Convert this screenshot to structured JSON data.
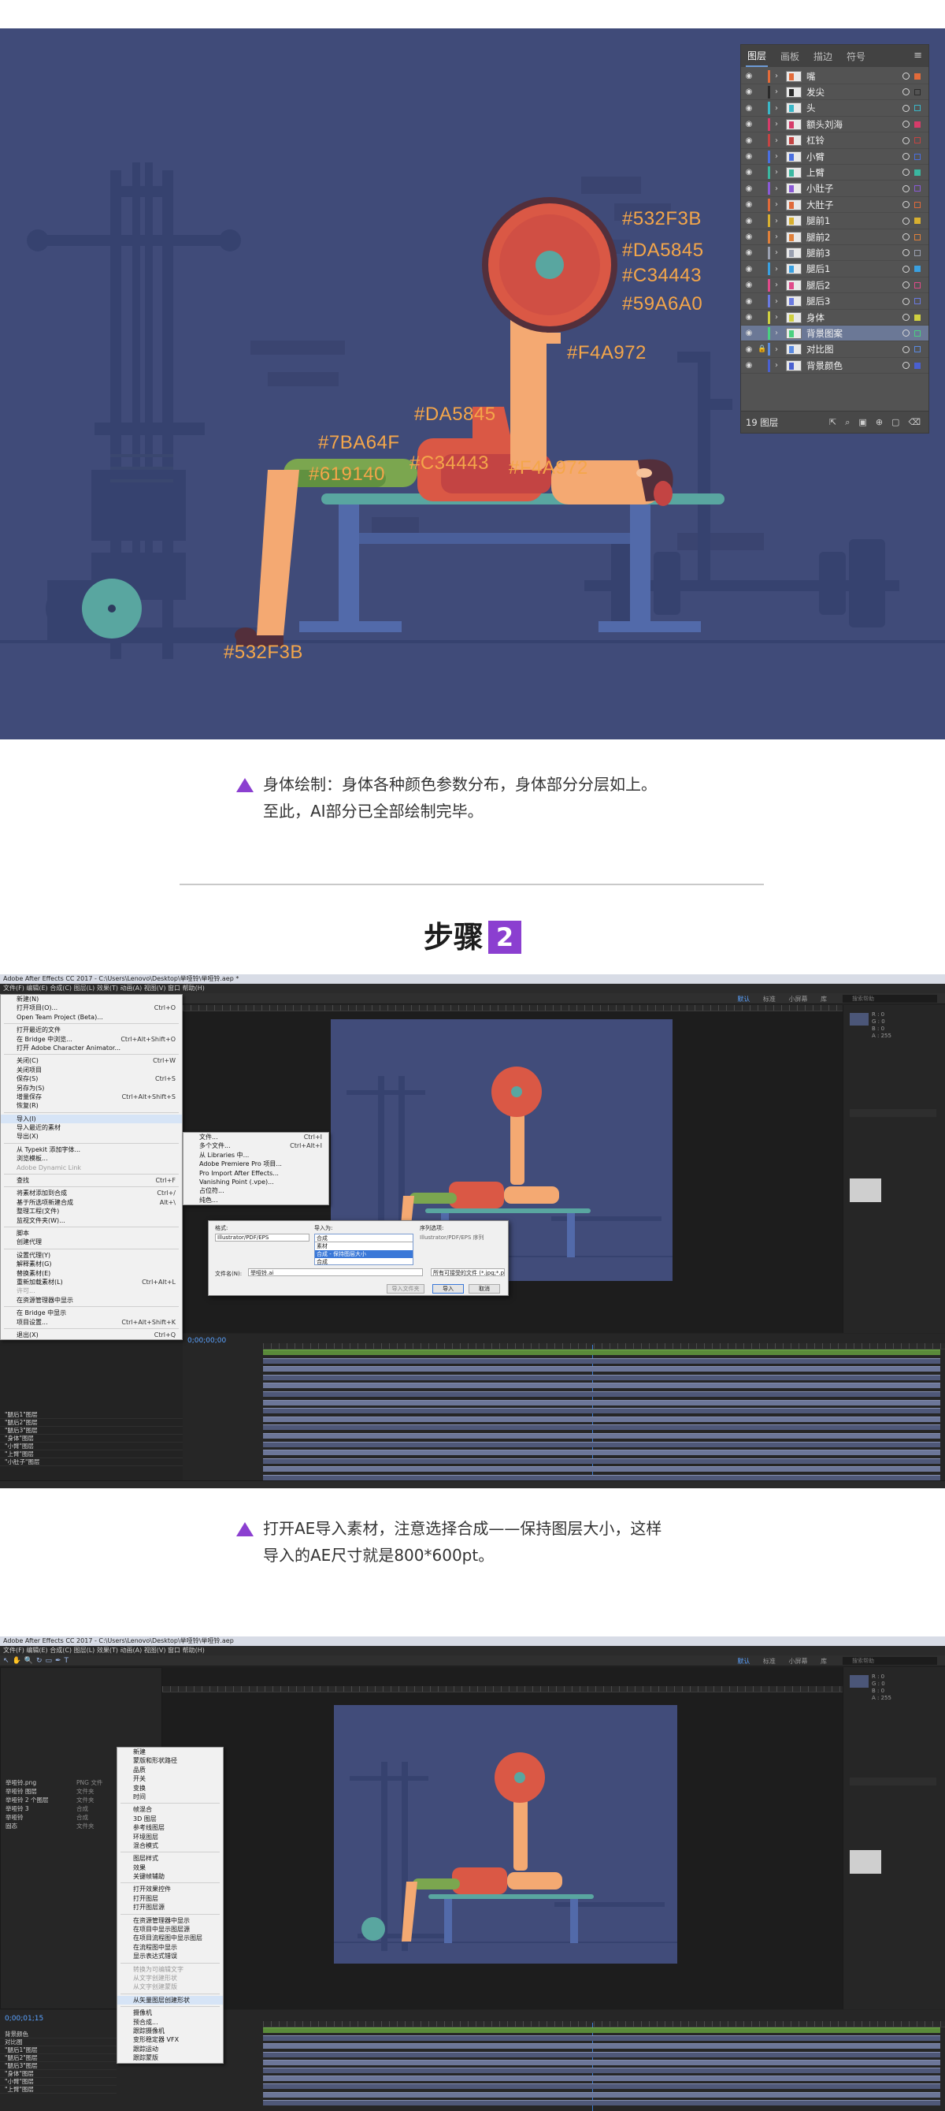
{
  "hero": {
    "background": "#404b79",
    "color_labels": [
      "#532F3B",
      "#DA5845",
      "#C34443",
      "#59A6A0",
      "#F4A972",
      "#DA5845",
      "#7BA64F",
      "#619140",
      "#C34443",
      "#F4A972",
      "#532F3B"
    ],
    "layers_panel": {
      "tabs": [
        "图层",
        "画板",
        "描边",
        "符号"
      ],
      "menu_icon": "hamburger-icon",
      "layers": [
        {
          "name": "嘴",
          "color": "#e36b3a"
        },
        {
          "name": "发尖",
          "color": "#2b2b2b"
        },
        {
          "name": "头",
          "color": "#3ab7c8"
        },
        {
          "name": "额头刘海",
          "color": "#d63c6a"
        },
        {
          "name": "杠铃",
          "color": "#c34443"
        },
        {
          "name": "小臂",
          "color": "#4a6fe0"
        },
        {
          "name": "上臂",
          "color": "#3ab7a0"
        },
        {
          "name": "小肚子",
          "color": "#8a5ad6"
        },
        {
          "name": "大肚子",
          "color": "#e06a3a"
        },
        {
          "name": "腿前1",
          "color": "#d8b030"
        },
        {
          "name": "腿前2",
          "color": "#e0803a"
        },
        {
          "name": "腿前3",
          "color": "#9aa0b0"
        },
        {
          "name": "腿后1",
          "color": "#3aa0e0"
        },
        {
          "name": "腿后2",
          "color": "#e04a8a"
        },
        {
          "name": "腿后3",
          "color": "#6a7ae0"
        },
        {
          "name": "身体",
          "color": "#d0d040"
        },
        {
          "name": "背景图案",
          "color": "#4ad080"
        },
        {
          "name": "对比图",
          "color": "#5a8ae0"
        },
        {
          "name": "背景颜色",
          "color": "#4a60d0"
        }
      ],
      "footer_count": "19 图层"
    }
  },
  "caption1": "身体绘制：身体各种颜色参数分布，身体部分分层如上。\n至此，AI部分已全部绘制完毕。",
  "step": {
    "label": "步骤",
    "number": "2"
  },
  "caption2": "打开AE导入素材，注意选择合成——保持图层大小，这样\n导入的AE尺寸就是800*600pt。",
  "ae1": {
    "title": "Adobe After Effects CC 2017 - C:\\Users\\Lenovo\\Desktop\\举哑铃\\举哑铃.aep *",
    "menu": "文件(F)   编辑(E)   合成(C)   图层(L)   效果(T)   动画(A)   视图(V)   窗口   帮助(H)",
    "workspace": [
      "默认",
      "标准",
      "小屏幕",
      "库"
    ],
    "search_placeholder": "搜索帮助",
    "file_menu": [
      {
        "label": "新建(N)",
        "shortcut": ""
      },
      {
        "label": "打开项目(O)...",
        "shortcut": "Ctrl+O"
      },
      {
        "label": "Open Team Project (Beta)...",
        "shortcut": ""
      },
      {
        "label": "打开最近的文件",
        "shortcut": ""
      },
      {
        "label": "在 Bridge 中浏览...",
        "shortcut": "Ctrl+Alt+Shift+O"
      },
      {
        "label": "打开 Adobe Character Animator...",
        "shortcut": ""
      },
      {
        "label": "关闭(C)",
        "shortcut": "Ctrl+W"
      },
      {
        "label": "关闭项目",
        "shortcut": ""
      },
      {
        "label": "保存(S)",
        "shortcut": "Ctrl+S"
      },
      {
        "label": "另存为(S)",
        "shortcut": ""
      },
      {
        "label": "增量保存",
        "shortcut": "Ctrl+Alt+Shift+S"
      },
      {
        "label": "恢复(R)",
        "shortcut": ""
      },
      {
        "label": "导入(I)",
        "shortcut": ""
      },
      {
        "label": "导入最近的素材",
        "shortcut": ""
      },
      {
        "label": "导出(X)",
        "shortcut": ""
      },
      {
        "label": "从 Typekit 添加字体...",
        "shortcut": ""
      },
      {
        "label": "浏览模板...",
        "shortcut": ""
      },
      {
        "label": "Adobe Dynamic Link",
        "shortcut": ""
      },
      {
        "label": "查找",
        "shortcut": "Ctrl+F"
      },
      {
        "label": "将素材添加到合成",
        "shortcut": "Ctrl+/"
      },
      {
        "label": "基于所选项新建合成",
        "shortcut": "Alt+\\"
      },
      {
        "label": "整理工程(文件)",
        "shortcut": ""
      },
      {
        "label": "监视文件夹(W)...",
        "shortcut": ""
      },
      {
        "label": "脚本",
        "shortcut": ""
      },
      {
        "label": "创建代理",
        "shortcut": ""
      },
      {
        "label": "设置代理(Y)",
        "shortcut": ""
      },
      {
        "label": "解释素材(G)",
        "shortcut": ""
      },
      {
        "label": "替换素材(E)",
        "shortcut": ""
      },
      {
        "label": "重新加载素材(L)",
        "shortcut": "Ctrl+Alt+L"
      },
      {
        "label": "许可...",
        "shortcut": ""
      },
      {
        "label": "在资源管理器中显示",
        "shortcut": ""
      },
      {
        "label": "在 Bridge 中显示",
        "shortcut": ""
      },
      {
        "label": "项目设置...",
        "shortcut": "Ctrl+Alt+Shift+K"
      },
      {
        "label": "退出(X)",
        "shortcut": "Ctrl+Q"
      }
    ],
    "import_submenu": [
      {
        "label": "文件...",
        "shortcut": "Ctrl+I"
      },
      {
        "label": "多个文件...",
        "shortcut": "Ctrl+Alt+I"
      },
      {
        "label": "从 Libraries 中...",
        "shortcut": ""
      },
      {
        "label": "Adobe Premiere Pro 项目...",
        "shortcut": ""
      },
      {
        "label": "Pro Import After Effects...",
        "shortcut": ""
      },
      {
        "label": "Vanishing Point (.vpe)...",
        "shortcut": ""
      },
      {
        "label": "占位符...",
        "shortcut": ""
      },
      {
        "label": "纯色...",
        "shortcut": ""
      }
    ],
    "dialog": {
      "format_label": "格式:",
      "format_value": "Illustrator/PDF/EPS",
      "import_as_label": "导入为:",
      "import_options": [
        "素材",
        "合成",
        "合成 - 保持图层大小"
      ],
      "selected_option": "合成 - 保持图层大小",
      "sequence_label": "序列选项:",
      "sequence_value": "Illustrator/PDF/EPS 序列",
      "filename_label": "文件名(N):",
      "filename_value": "举哑铃.ai",
      "filetype_value": "所有可接受的文件 (*.jpg;*.png)",
      "import_folder_btn": "导入文件夹",
      "import_btn": "导入",
      "cancel_btn": "取消"
    },
    "timecode": "0;00;00;00",
    "timeline_layers": [
      "\"腿后1\"图层",
      "\"腿后2\"图层",
      "\"腿后3\"图层",
      "\"身体\"图层",
      "\"小臂\"图层",
      "\"上臂\"图层",
      "\"小肚子\"图层"
    ]
  },
  "ae2": {
    "title": "Adobe After Effects CC 2017 - C:\\Users\\Lenovo\\Desktop\\举哑铃\\举哑铃.aep",
    "menu": "文件(F)   编辑(E)   合成(C)   图层(L)   效果(T)   动画(A)   视图(V)   窗口   帮助(H)",
    "project_items": [
      {
        "name": "举哑铃.png",
        "type": "PNG 文件"
      },
      {
        "name": "举哑铃 图层",
        "type": "文件夹"
      },
      {
        "name": "举哑铃 2 个图层",
        "type": "文件夹"
      },
      {
        "name": "举哑铃 3",
        "type": "合成"
      },
      {
        "name": "举哑铃",
        "type": "合成"
      },
      {
        "name": "固态",
        "type": "文件夹"
      }
    ],
    "context_menu": [
      {
        "label": "新建",
        "dim": false
      },
      {
        "label": "蒙版和形状路径",
        "dim": false
      },
      {
        "label": "品质",
        "dim": false
      },
      {
        "label": "开关",
        "dim": false
      },
      {
        "label": "变换",
        "dim": false
      },
      {
        "label": "时间",
        "dim": false
      },
      {
        "label": "帧混合",
        "dim": false
      },
      {
        "label": "3D 图层",
        "dim": false
      },
      {
        "label": "参考线图层",
        "dim": false
      },
      {
        "label": "环境图层",
        "dim": false
      },
      {
        "label": "混合模式",
        "dim": false
      },
      {
        "label": "图层样式",
        "dim": false
      },
      {
        "label": "效果",
        "dim": false
      },
      {
        "label": "关键帧辅助",
        "dim": false
      },
      {
        "label": "打开效果控件",
        "dim": false
      },
      {
        "label": "打开图层",
        "dim": false
      },
      {
        "label": "打开图层源",
        "dim": false
      },
      {
        "label": "在资源管理器中显示",
        "dim": false
      },
      {
        "label": "在项目中显示图层源",
        "dim": false
      },
      {
        "label": "在项目流程图中显示图层",
        "dim": false
      },
      {
        "label": "在流程图中显示",
        "dim": false
      },
      {
        "label": "显示表达式错误",
        "dim": false
      },
      {
        "label": "转换为可编辑文字",
        "dim": true
      },
      {
        "label": "从文字创建形状",
        "dim": true
      },
      {
        "label": "从文字创建蒙版",
        "dim": true
      },
      {
        "label": "从矢量图层创建形状",
        "dim": false
      },
      {
        "label": "摄像机",
        "dim": false
      },
      {
        "label": "预合成...",
        "dim": false
      },
      {
        "label": "跟踪摄像机",
        "dim": false
      },
      {
        "label": "变形稳定器 VFX",
        "dim": false
      },
      {
        "label": "跟踪运动",
        "dim": false
      },
      {
        "label": "跟踪蒙版",
        "dim": false
      }
    ],
    "timecode": "0;00;01;15",
    "timeline_layers": [
      "背景颜色",
      "对比图",
      "\"腿后1\"图层",
      "\"腿后2\"图层",
      "\"腿后3\"图层",
      "\"身体\"图层",
      "\"小臂\"图层",
      "\"上臂\"图层"
    ]
  }
}
